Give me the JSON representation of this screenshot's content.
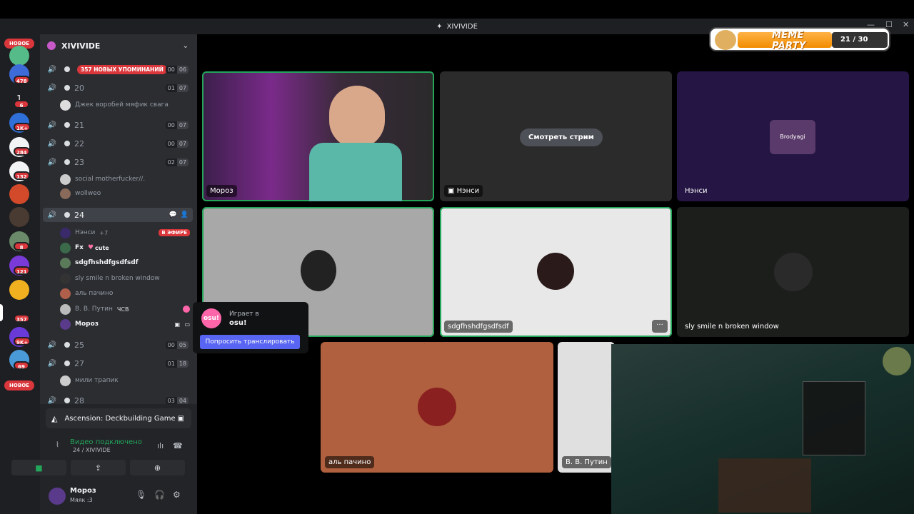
{
  "window": {
    "title": "XIVIVIDE",
    "controls": [
      "—",
      "☐",
      "✕"
    ]
  },
  "guilds": {
    "new_top": "НОВОЕ",
    "new_bottom": "НОВОЕ",
    "badges": [
      "478",
      "6",
      "1K+",
      "284",
      "132",
      "8",
      "121",
      "357",
      "9K+",
      "69"
    ],
    "dm_count": "1"
  },
  "server": {
    "name": "XIVIVIDE"
  },
  "channels": [
    {
      "name": "",
      "mention": "357 НОВЫХ УПОМИНАНИЙ",
      "count": [
        "00",
        "06"
      ]
    },
    {
      "name": "20",
      "count": [
        "01",
        "07"
      ],
      "users": [
        "Джек воробей мяфик свага"
      ]
    },
    {
      "name": "21",
      "count": [
        "00",
        "07"
      ]
    },
    {
      "name": "22",
      "count": [
        "00",
        "07"
      ]
    },
    {
      "name": "23",
      "count": [
        "02",
        "07"
      ],
      "users": [
        "social motherfucker//.",
        "wollweo"
      ]
    },
    {
      "name": "24",
      "active": true
    },
    {
      "name": "25",
      "count": [
        "00",
        "05"
      ]
    },
    {
      "name": "27",
      "count": [
        "01",
        "18"
      ],
      "users": [
        "мили трапик"
      ]
    },
    {
      "name": "28",
      "count": [
        "03",
        "04"
      ]
    }
  ],
  "channel24_users": [
    {
      "name": "Нэнси",
      "extra": "+7",
      "live": "В ЭФИРЕ"
    },
    {
      "name": "Fx",
      "extra": "cute"
    },
    {
      "name": "sdgfhshdfgsdfsdf"
    },
    {
      "name": "sly smile n broken window"
    },
    {
      "name": "аль пачино"
    },
    {
      "name": "В. В. Путин",
      "extra": "ЧСВ"
    },
    {
      "name": "Мороз"
    }
  ],
  "activity": {
    "game": "Ascension: Deckbuilding Game"
  },
  "voice_status": {
    "connected": "Видео подключено",
    "location": "24 / XIVIVIDE"
  },
  "user": {
    "name": "Мороз",
    "status": "Мяяк :3"
  },
  "tiles": {
    "moroz": "Мороз",
    "nancy_stream": "Нэнси",
    "watch_stream": "Смотреть стрим",
    "nancy": "Нэнси",
    "brodyagi": "Brodyagi",
    "sdgf": "sdgfhshdfgsdfsdf",
    "sly": "sly smile n broken window",
    "pacino": "аль пачино",
    "putin": "В. В. Путин"
  },
  "popup": {
    "playing": "Играет в",
    "game": "osu!",
    "logo": "osu!",
    "ask": "Попросить транслировать"
  },
  "overlay": {
    "title": "MEME PARTY",
    "counter": "21 / 30"
  },
  "colors": {
    "green": "#23a55a",
    "red": "#da373c",
    "blurple": "#5865f2"
  }
}
